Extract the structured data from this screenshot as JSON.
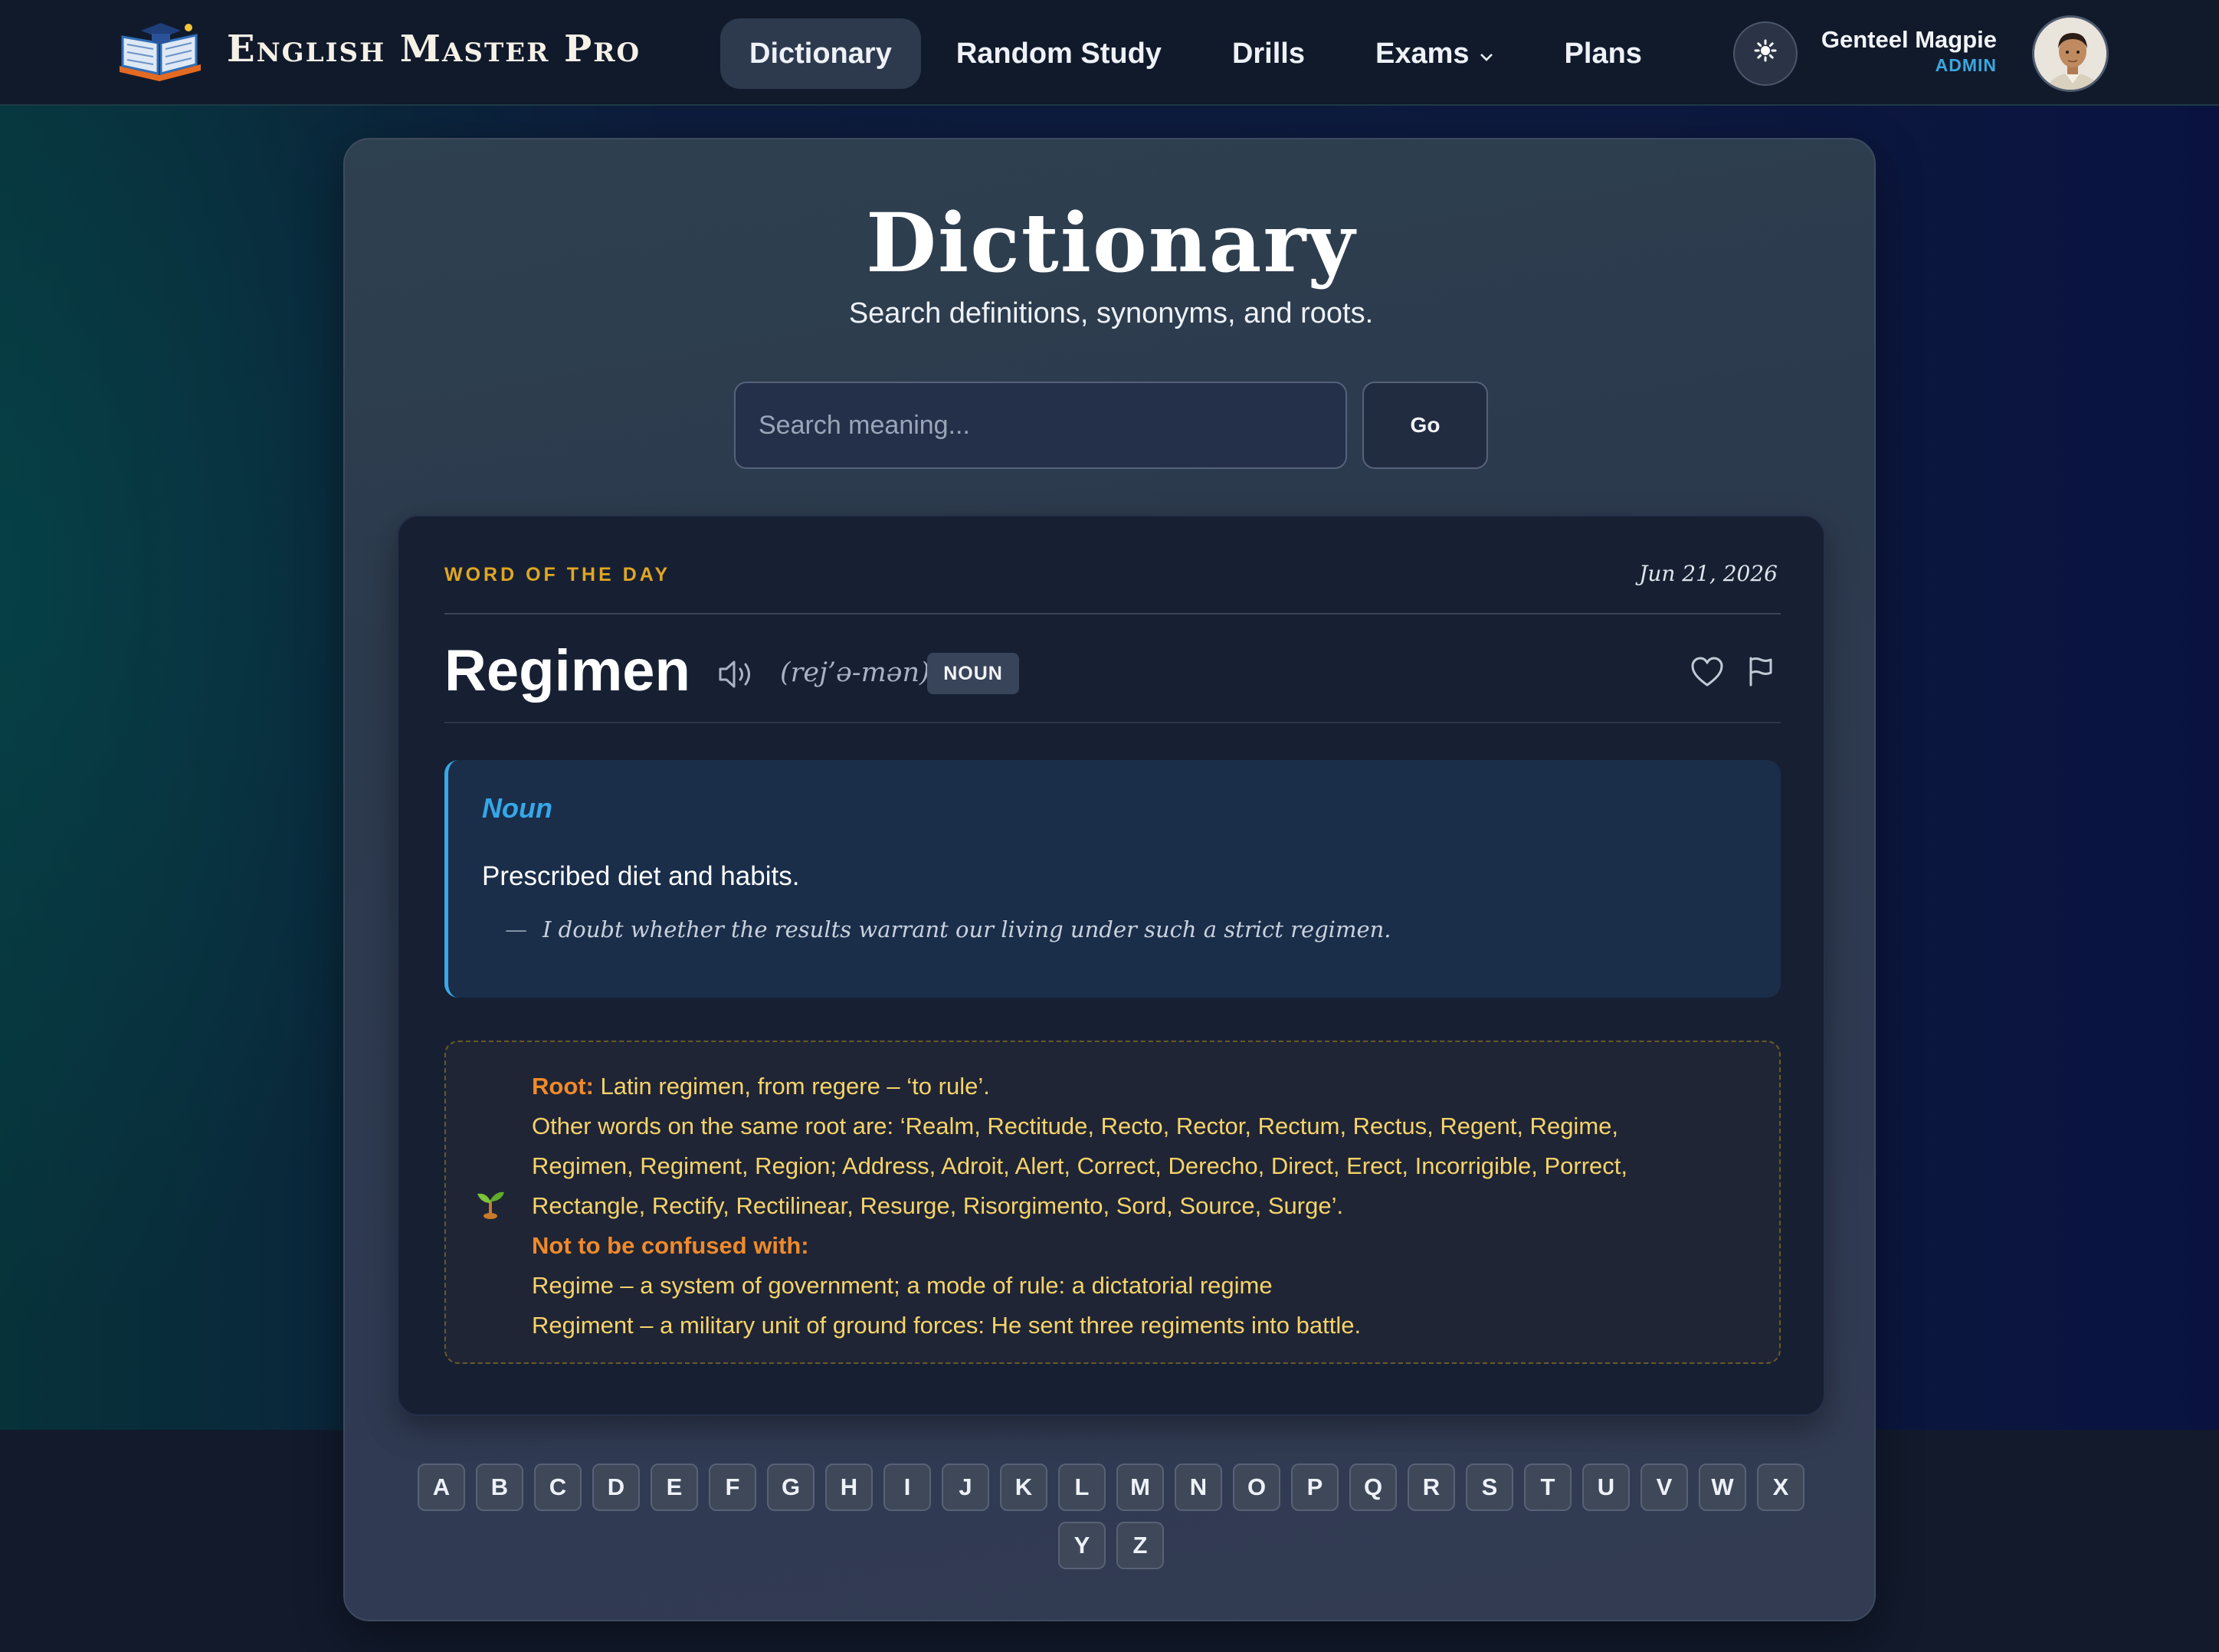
{
  "header": {
    "brand": "English Master Pro",
    "nav": [
      {
        "label": "Dictionary",
        "active": true
      },
      {
        "label": "Random Study",
        "active": false
      },
      {
        "label": "Drills",
        "active": false
      },
      {
        "label": "Exams",
        "active": false,
        "has_dropdown": true
      },
      {
        "label": "Plans",
        "active": false
      }
    ],
    "theme_icon": "sun-icon",
    "user": {
      "name": "Genteel Magpie",
      "role": "ADMIN"
    }
  },
  "page": {
    "title": "Dictionary",
    "subtitle": "Search definitions, synonyms, and roots.",
    "search": {
      "placeholder": "Search meaning...",
      "value": "",
      "button": "Go"
    }
  },
  "word_of_day": {
    "label": "WORD OF THE DAY",
    "date": "Jun 21, 2026",
    "word": "Regimen",
    "pronunciation": "(rej’ə-mən)",
    "part_of_speech_badge": "NOUN",
    "definition": {
      "pos": "Noun",
      "text": "Prescribed diet and habits.",
      "example": "I doubt whether the results warrant our living under such a strict regimen.",
      "example_dash": "—"
    },
    "root": {
      "root_label": "Root:",
      "root_text": "Latin regimen, from regere – ‘to rule’.",
      "other_words_line1": "Other words on the same root are: ‘Realm, Rectitude, Recto, Rector, Rectum, Rectus, Regent, Regime,",
      "other_words_line2": "Regimen, Regiment, Region; Address, Adroit, Alert, Correct, Derecho, Direct, Erect, Incorrigible, Porrect,",
      "other_words_line3": "Rectangle, Rectify, Rectilinear, Resurge, Risorgimento, Sord, Source, Surge’.",
      "confused_label": "Not to be confused with:",
      "confused_1": "Regime – a system of government; a mode of rule: a dictatorial regime",
      "confused_2": "Regiment – a military unit of ground forces: He sent three regiments into battle."
    }
  },
  "alphabet": [
    "A",
    "B",
    "C",
    "D",
    "E",
    "F",
    "G",
    "H",
    "I",
    "J",
    "K",
    "L",
    "M",
    "N",
    "O",
    "P",
    "Q",
    "R",
    "S",
    "T",
    "U",
    "V",
    "W",
    "X",
    "Y",
    "Z"
  ],
  "colors": {
    "accent_blue": "#39a9e6",
    "accent_gold": "#e1a722",
    "root_text": "#f6d36a",
    "root_highlight": "#f08a2a"
  }
}
